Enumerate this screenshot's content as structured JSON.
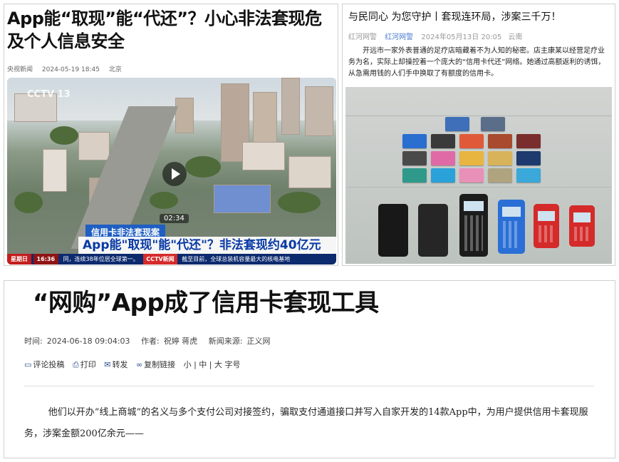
{
  "panel1": {
    "title": "App能“取现”能“代还”？小心非法套现危及个人信息安全",
    "source": "央视新闻",
    "datetime": "2024-05-19 18:45",
    "location": "北京",
    "video": {
      "watermark": "CCTV 13",
      "duration": "02:34",
      "tag": "信用卡非法套现案",
      "headline": "App能\"取现\"能\"代还\"？非法套现约40亿元",
      "ticker_day": "星期日",
      "ticker_time": "16:36",
      "ticker_logo": "CCTV新闻",
      "ticker_left": "同，连续38年位居全球第一。",
      "ticker_right": "截至目前，全球总装机容量最大的核电基地"
    }
  },
  "panel2": {
    "title": "与民同心 为您守护丨套现连环局，涉案三千万！",
    "source1": "红河网警",
    "source2": "红河网警",
    "datetime": "2024年05月13日 20:05",
    "location": "云南",
    "body": "开远市一家外表普通的足疗店暗藏着不为人知的秘密。店主康某以经营足疗业务为名，实际上却操控着一个庞大的“信用卡代还”网络。她通过高额返利的诱饵，从急需用钱的人们手中换取了有额度的信用卡。"
  },
  "panel3": {
    "title": "“网购”App成了信用卡套现工具",
    "time_label": "时间:",
    "time": "2024-06-18 09:04:03",
    "author_label": "作者:",
    "author": "祝婷 蒋虎",
    "source_label": "新闻来源:",
    "source": "正义网",
    "tools": {
      "comment": "评论投稿",
      "print": "打印",
      "forward": "转发",
      "copy": "复制链接",
      "font_size": "小 | 中 | 大 字号"
    },
    "body": "他们以开办“线上商城”的名义与多个支付公司对接签约，骗取支付通道接口并写入自家开发的14款App中，为用户提供信用卡套现服务，涉案金额200亿余元——"
  },
  "colors": {
    "cctv_blue": "#1f5fc3",
    "headline_blue": "#0a3aa6",
    "link_blue": "#4a7bd0",
    "pos_red": "#d42a2a",
    "pos_blue": "#2a6fd6"
  }
}
